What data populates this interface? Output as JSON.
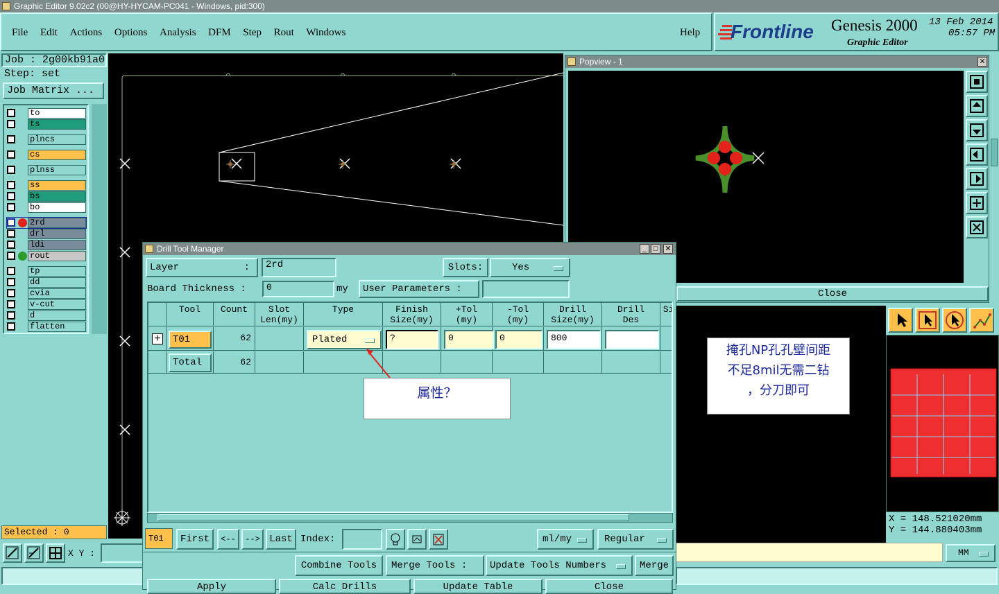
{
  "window": {
    "title": "Graphic Editor 9.02c2 (00@HY-HYCAM-PC041 - Windows, pid:300)"
  },
  "menu": [
    "File",
    "Edit",
    "Actions",
    "Options",
    "Analysis",
    "DFM",
    "Step",
    "Rout",
    "Windows"
  ],
  "help": "Help",
  "brand": {
    "logo": "Frontline",
    "product": "Genesis 2000",
    "sub": "Graphic Editor",
    "date": "13 Feb 2014",
    "time": "05:57 PM"
  },
  "job": {
    "job": "Job : 2g00kb91a0",
    "step": "Step: set",
    "matrix": "Job Matrix ..."
  },
  "layers": [
    {
      "name": "to",
      "color": "#ffffff",
      "group": 0
    },
    {
      "name": "ts",
      "color": "#1e9c7a",
      "group": 0
    },
    {
      "name": "plncs",
      "color": "#8fd7cf",
      "group": 1
    },
    {
      "name": "cs",
      "color": "#ffc04c",
      "group": 2
    },
    {
      "name": "plnss",
      "color": "#8fd7cf",
      "group": 3
    },
    {
      "name": "ss",
      "color": "#ffc04c",
      "group": 4
    },
    {
      "name": "bs",
      "color": "#1e9c7a",
      "group": 4
    },
    {
      "name": "bo",
      "color": "#ffffff",
      "group": 4
    },
    {
      "name": "2rd",
      "color": "#7a8c9c",
      "group": 5
    },
    {
      "name": "drl",
      "color": "#7a8c9c",
      "group": 5
    },
    {
      "name": "ldi",
      "color": "#7a8c9c",
      "group": 5
    },
    {
      "name": "rout",
      "color": "#c8c8c8",
      "group": 5
    },
    {
      "name": "tp",
      "color": "#8fd7cf",
      "group": 6
    },
    {
      "name": "dd",
      "color": "#8fd7cf",
      "group": 6
    },
    {
      "name": "cvia",
      "color": "#8fd7cf",
      "group": 6
    },
    {
      "name": "v-cut",
      "color": "#8fd7cf",
      "group": 6
    },
    {
      "name": "d",
      "color": "#8fd7cf",
      "group": 6
    },
    {
      "name": "flatten",
      "color": "#8fd7cf",
      "group": 6
    }
  ],
  "selected": "Selected : 0",
  "xy_label": "X Y :",
  "popview": {
    "title": "Popview - 1",
    "close": "Close"
  },
  "coords": {
    "x": "X  =  148.521020mm",
    "y": "Y  =  144.880403mm"
  },
  "units": "MM",
  "note_annotation": "掩孔NP孔孔壁间距\n不足8mil无需二钻\n，分刀即可",
  "dtm": {
    "title": "Drill Tool Manager",
    "layer_label": "Layer",
    "layer_value": "2rd",
    "slots_label": "Slots:",
    "slots_value": "Yes",
    "thickness_label": "Board Thickness :",
    "thickness_value": "0",
    "thickness_unit": "my",
    "user_params": "User Parameters :",
    "headers": [
      "Tool",
      "Count",
      "Slot\nLen(my)",
      "Type",
      "Finish\nSize(my)",
      "+Tol\n(my)",
      "-Tol\n(my)",
      "Drill\nSize(my)",
      "Drill\nDes",
      "Si"
    ],
    "row": {
      "tool": "T01",
      "count": "62",
      "type": "Plated",
      "finish": "?",
      "ptol": "0",
      "ntol": "0",
      "drill": "800",
      "des": ""
    },
    "total": {
      "label": "Total",
      "count": "62"
    },
    "callout": "属性？",
    "nav": {
      "cur": "T01",
      "first": "First",
      "prev": "<--",
      "next": "-->",
      "last": "Last",
      "index": "Index:",
      "unit": "ml/my",
      "mode": "Regular"
    },
    "actions": {
      "combine": "Combine Tools",
      "merge_label": "Merge Tools :",
      "update": "Update Tools Numbers",
      "merge": "Merge"
    },
    "bottom": [
      "Apply",
      "Calc Drills",
      "Update Table",
      "Close"
    ]
  }
}
